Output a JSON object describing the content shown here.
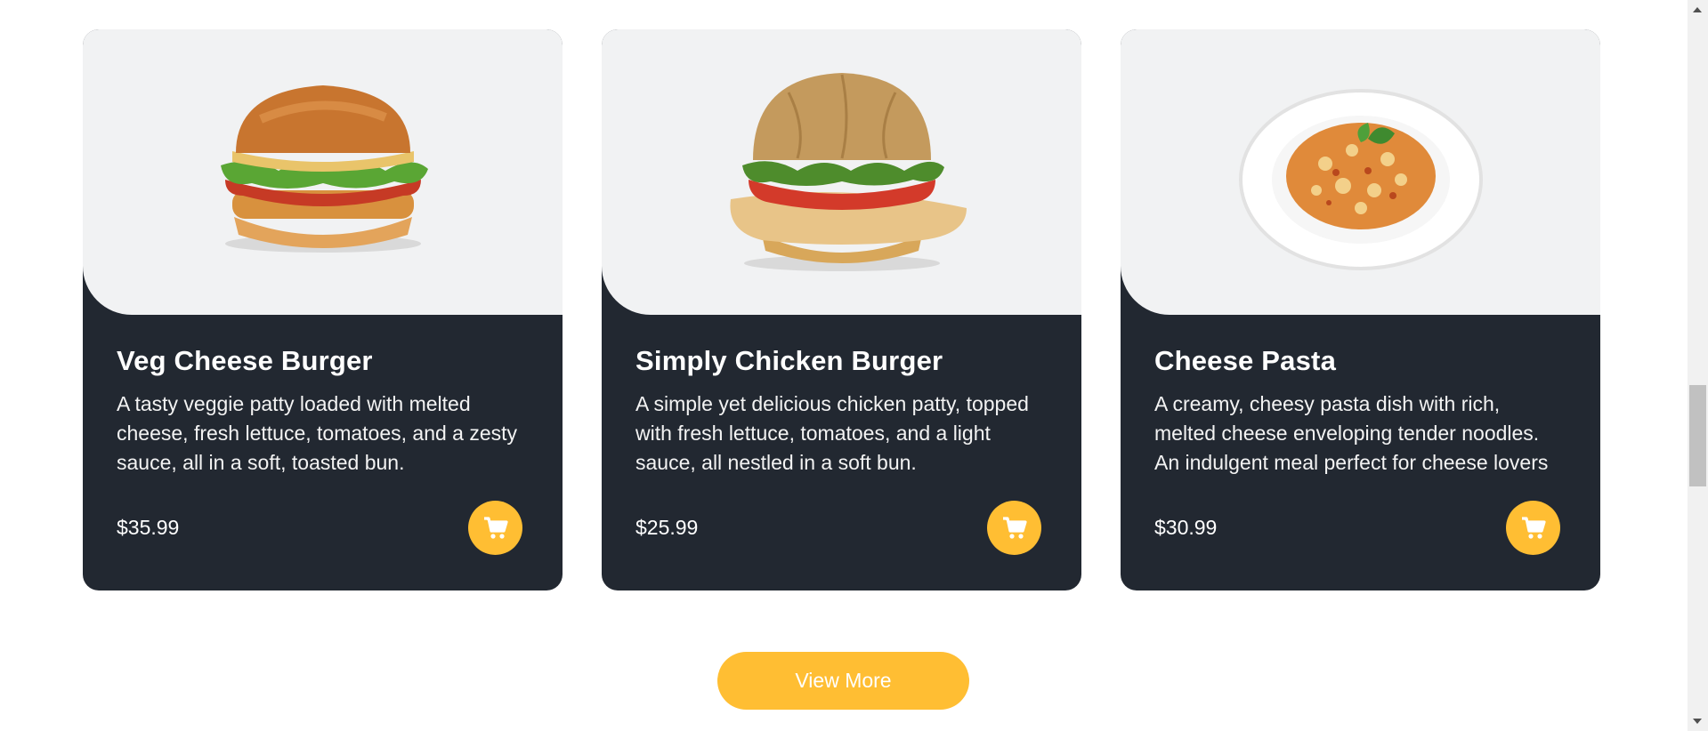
{
  "cards": [
    {
      "title": "Veg Cheese Burger",
      "description": "A tasty veggie patty loaded with melted cheese, fresh lettuce, tomatoes, and a zesty sauce, all in a soft, toasted bun.",
      "price": "$35.99",
      "image_icon": "burger-image",
      "cart_icon": "cart-icon"
    },
    {
      "title": "Simply Chicken Burger",
      "description": "A simple yet delicious chicken patty, topped with fresh lettuce, tomatoes, and a light sauce, all nestled in a soft bun.",
      "price": "$25.99",
      "image_icon": "chicken-burger-image",
      "cart_icon": "cart-icon"
    },
    {
      "title": "Cheese Pasta",
      "description": "A creamy, cheesy pasta dish with rich, melted cheese enveloping tender noodles. An indulgent meal perfect for cheese lovers",
      "price": "$30.99",
      "image_icon": "pasta-image",
      "cart_icon": "cart-icon"
    }
  ],
  "view_more_label": "View More",
  "colors": {
    "card_bg": "#222831",
    "image_bg": "#f1f2f3",
    "accent": "#ffbe33"
  }
}
